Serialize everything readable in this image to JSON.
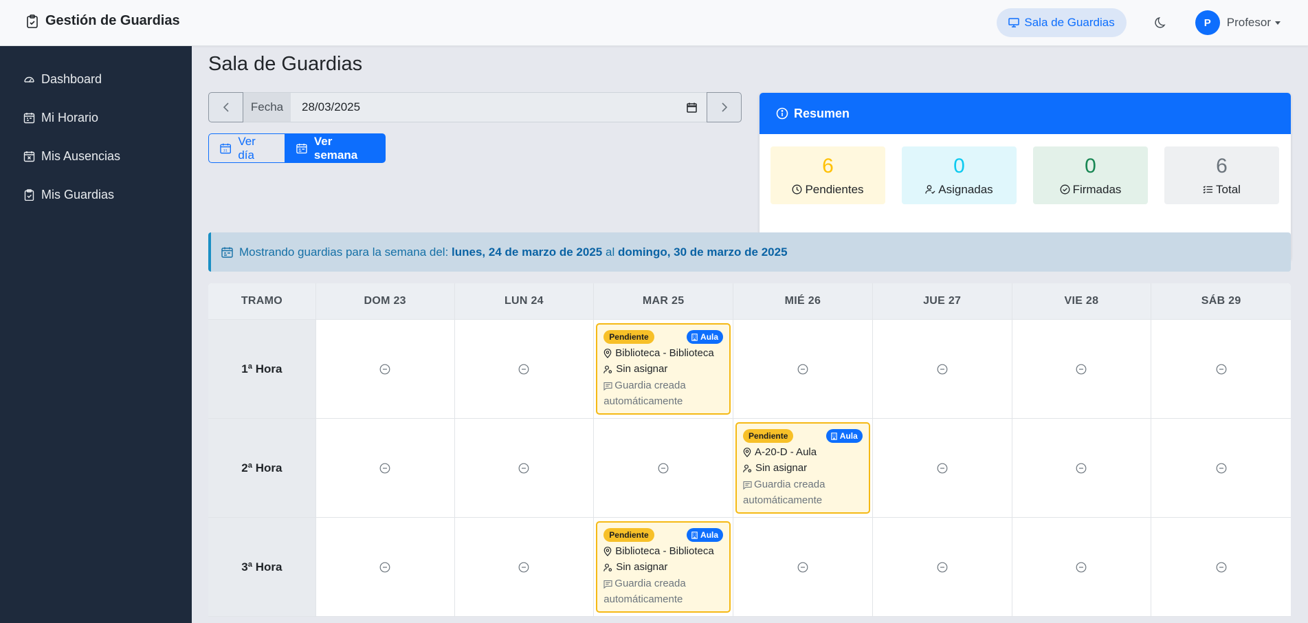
{
  "brand": {
    "title": "Gestión de Guardias",
    "icon": "clipboard-check-icon"
  },
  "topnav": {
    "sala_label": "Sala de Guardias",
    "user_initial": "P",
    "user_name": "Profesor"
  },
  "sidebar": {
    "items": [
      {
        "label": "Dashboard",
        "icon": "speedometer-icon"
      },
      {
        "label": "Mi Horario",
        "icon": "calendar-week-icon"
      },
      {
        "label": "Mis Ausencias",
        "icon": "calendar-x-icon"
      },
      {
        "label": "Mis Guardias",
        "icon": "clipboard-check-icon"
      }
    ]
  },
  "main": {
    "title": "Sala de Guardias",
    "fecha_label": "Fecha",
    "fecha_value": "28/03/2025",
    "view_day": "Ver día",
    "view_week": "Ver semana"
  },
  "resumen": {
    "title": "Resumen",
    "stats": [
      {
        "value": "6",
        "label": "Pendientes",
        "color": "#ffc107",
        "bg": "#fff8de"
      },
      {
        "value": "0",
        "label": "Asignadas",
        "color": "#0dcaf0",
        "bg": "#e0f7fc"
      },
      {
        "value": "0",
        "label": "Firmadas",
        "color": "#198754",
        "bg": "#e3f1e9"
      },
      {
        "value": "6",
        "label": "Total",
        "color": "#6c757d",
        "bg": "#eef0f2"
      }
    ]
  },
  "alert": {
    "prefix": "Mostrando guardias para la semana del:",
    "start": "lunes, 24 de marzo de 2025",
    "mid": "al",
    "end": "domingo, 30 de marzo de 2025"
  },
  "table": {
    "headers": [
      "TRAMO",
      "DOM 23",
      "LUN 24",
      "MAR 25",
      "MIÉ 26",
      "JUE 27",
      "VIE 28",
      "SÁB 29"
    ],
    "rows": [
      {
        "tramo": "1ª Hora"
      },
      {
        "tramo": "2ª Hora"
      },
      {
        "tramo": "3ª Hora"
      }
    ],
    "guardias": [
      {
        "estado": "Pendiente",
        "tipo": "Aula",
        "lugar": "Biblioteca - Biblioteca",
        "profesor": "Sin asignar",
        "obs": "Guardia creada automáticamente"
      },
      {
        "estado": "Pendiente",
        "tipo": "Aula",
        "lugar": "A-20-D - Aula",
        "profesor": "Sin asignar",
        "obs": "Guardia creada automáticamente"
      },
      {
        "estado": "Pendiente",
        "tipo": "Aula",
        "lugar": "Biblioteca - Biblioteca",
        "profesor": "Sin asignar",
        "obs": "Guardia creada automáticamente"
      }
    ]
  }
}
